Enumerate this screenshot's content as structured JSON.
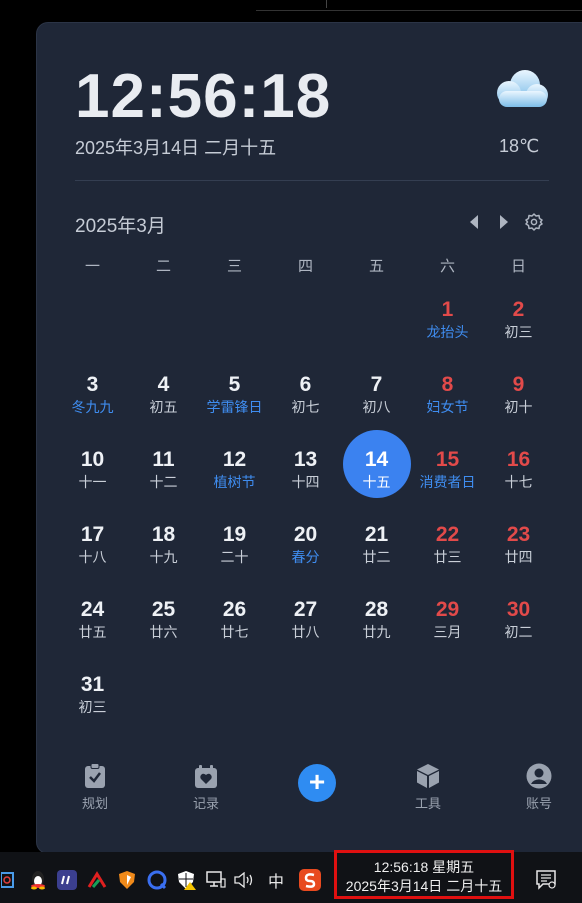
{
  "clock": {
    "time": "12:56:18",
    "date": "2025年3月14日 二月十五"
  },
  "weather": {
    "icon": "cloud-icon",
    "temp": "18℃"
  },
  "calendar": {
    "month_title": "2025年3月",
    "weekdays": [
      "一",
      "二",
      "三",
      "四",
      "五",
      "六",
      "日"
    ],
    "days": [
      {
        "num": "",
        "lunar": ""
      },
      {
        "num": "",
        "lunar": ""
      },
      {
        "num": "",
        "lunar": ""
      },
      {
        "num": "",
        "lunar": ""
      },
      {
        "num": "",
        "lunar": ""
      },
      {
        "num": "1",
        "lunar": "龙抬头",
        "weekend": true,
        "festival": true
      },
      {
        "num": "2",
        "lunar": "初三",
        "weekend": true
      },
      {
        "num": "3",
        "lunar": "冬九九",
        "festival": true
      },
      {
        "num": "4",
        "lunar": "初五"
      },
      {
        "num": "5",
        "lunar": "学雷锋日",
        "festival": true
      },
      {
        "num": "6",
        "lunar": "初七"
      },
      {
        "num": "7",
        "lunar": "初八"
      },
      {
        "num": "8",
        "lunar": "妇女节",
        "weekend": true,
        "festival": true
      },
      {
        "num": "9",
        "lunar": "初十",
        "weekend": true
      },
      {
        "num": "10",
        "lunar": "十一"
      },
      {
        "num": "11",
        "lunar": "十二"
      },
      {
        "num": "12",
        "lunar": "植树节",
        "festival": true
      },
      {
        "num": "13",
        "lunar": "十四"
      },
      {
        "num": "14",
        "lunar": "十五",
        "today": true
      },
      {
        "num": "15",
        "lunar": "消费者日",
        "weekend": true,
        "festival": true
      },
      {
        "num": "16",
        "lunar": "十七",
        "weekend": true
      },
      {
        "num": "17",
        "lunar": "十八"
      },
      {
        "num": "18",
        "lunar": "十九"
      },
      {
        "num": "19",
        "lunar": "二十"
      },
      {
        "num": "20",
        "lunar": "春分",
        "festival": true
      },
      {
        "num": "21",
        "lunar": "廿二"
      },
      {
        "num": "22",
        "lunar": "廿三",
        "weekend": true
      },
      {
        "num": "23",
        "lunar": "廿四",
        "weekend": true
      },
      {
        "num": "24",
        "lunar": "廿五"
      },
      {
        "num": "25",
        "lunar": "廿六"
      },
      {
        "num": "26",
        "lunar": "廿七"
      },
      {
        "num": "27",
        "lunar": "廿八"
      },
      {
        "num": "28",
        "lunar": "廿九"
      },
      {
        "num": "29",
        "lunar": "三月",
        "weekend": true
      },
      {
        "num": "30",
        "lunar": "初二",
        "weekend": true
      },
      {
        "num": "31",
        "lunar": "初三"
      }
    ]
  },
  "toolbar": {
    "plan_label": "规划",
    "record_label": "记录",
    "add_label": "+",
    "tools_label": "工具",
    "account_label": "账号"
  },
  "taskbar": {
    "ime_label": "中",
    "clock_line1": "12:56:18 星期五",
    "clock_line2": "2025年3月14日 二月十五",
    "colors": {
      "highlight": "#e01010"
    }
  }
}
